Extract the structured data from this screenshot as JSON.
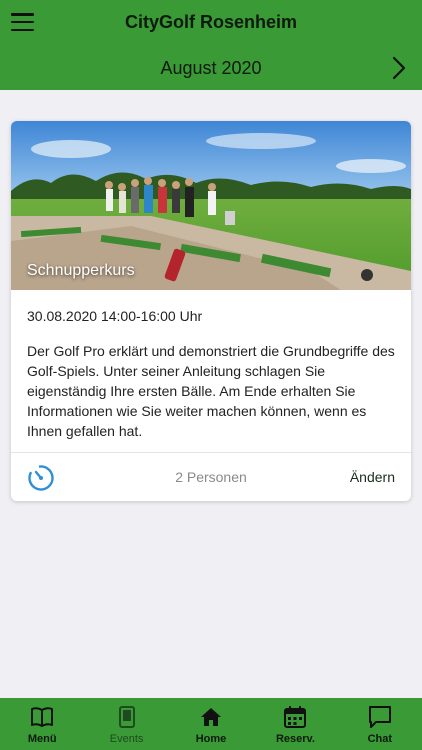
{
  "header": {
    "title": "CityGolf Rosenheim",
    "month": "August 2020",
    "menu_icon": "hamburger-menu-icon",
    "next_icon": "chevron-right-icon",
    "color": "#3a9a35"
  },
  "event_card": {
    "image_title": "Schnupperkurs",
    "datetime": "30.08.2020 14:00-16:00 Uhr",
    "description": "Der Golf Pro erklärt und demonstriert die Grundbegriffe des Golf-Spiels. Unter seiner Anleitung schlagen Sie eigenständig Ihre ersten Bälle. Am Ende erhalten Sie Informationen wie Sie weiter machen können, wenn es Ihnen gefallen hat.",
    "persons": "2 Personen",
    "edit_label": "Ändern",
    "timer_icon": "timer-icon",
    "accent": "#2f8fd8"
  },
  "tabbar": {
    "items": [
      {
        "label": "Menü",
        "icon": "book-icon"
      },
      {
        "label": "Events",
        "icon": "tablet-icon"
      },
      {
        "label": "Home",
        "icon": "home-icon"
      },
      {
        "label": "Reserv.",
        "icon": "calendar-icon"
      },
      {
        "label": "Chat",
        "icon": "chat-icon"
      }
    ]
  }
}
